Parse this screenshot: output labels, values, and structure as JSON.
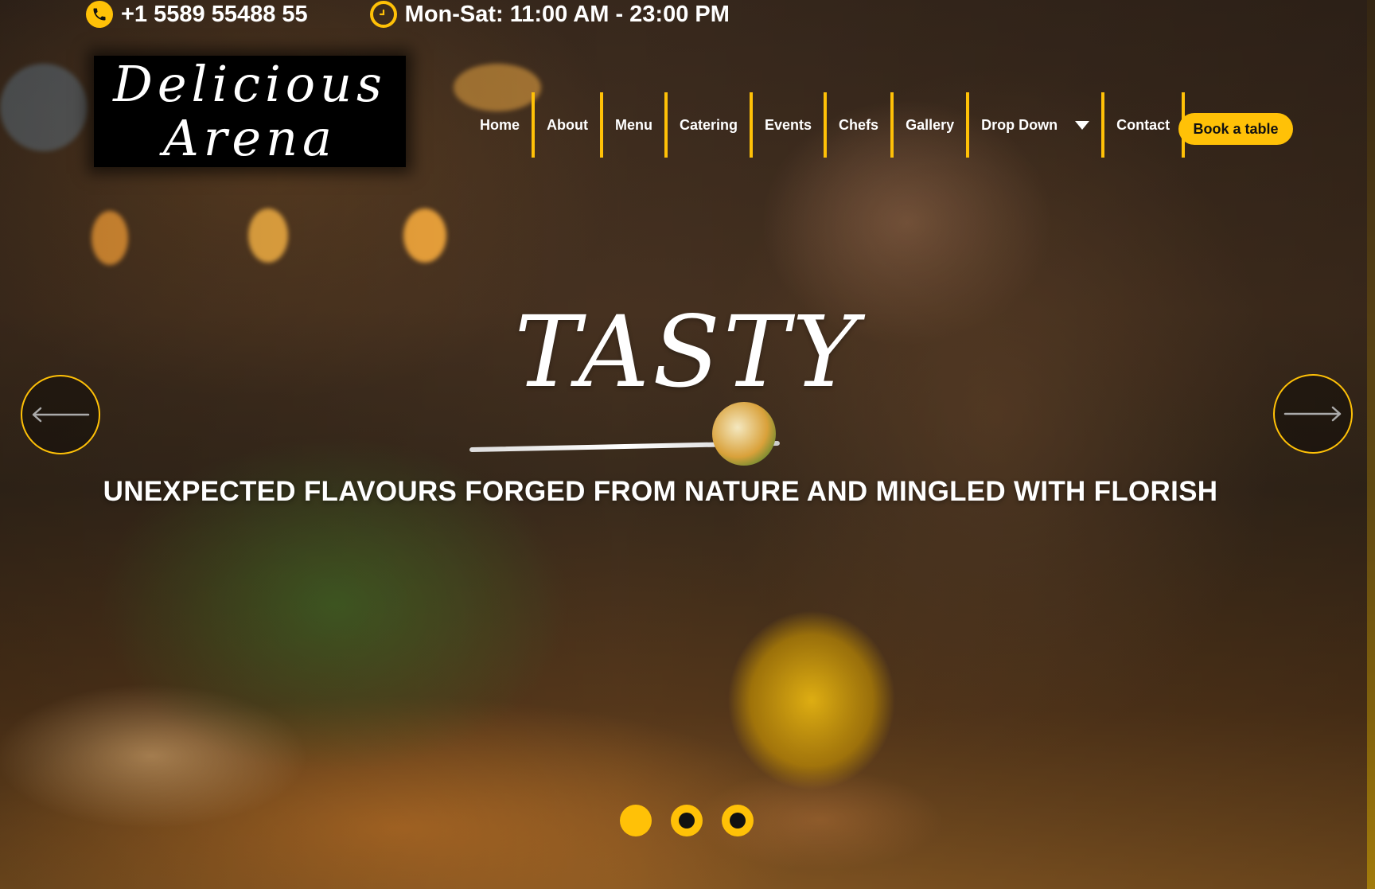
{
  "topbar": {
    "phone": "+1 5589 55488 55",
    "hours": "Mon-Sat: 11:00 AM - 23:00 PM"
  },
  "logo": {
    "line1": "Delicious",
    "line2": "Arena"
  },
  "nav": {
    "items": [
      {
        "label": "Home"
      },
      {
        "label": "About"
      },
      {
        "label": "Menu"
      },
      {
        "label": "Catering"
      },
      {
        "label": "Events"
      },
      {
        "label": "Chefs"
      },
      {
        "label": "Gallery"
      },
      {
        "label": "Drop Down"
      },
      {
        "label": "Contact"
      }
    ],
    "book_label": "Book a table"
  },
  "hero": {
    "title": "TASTY",
    "subtitle": "UNEXPECTED FLAVOURS FORGED FROM NATURE AND MINGLED WITH FLORISH",
    "slide_count": 3,
    "active_slide": 1
  },
  "colors": {
    "accent": "#ffc107",
    "text": "#ffffff"
  },
  "icons": {
    "phone": "phone-icon",
    "hours": "clock-icon",
    "prev": "arrow-left-icon",
    "next": "arrow-right-icon",
    "dropdown": "caret-down-icon"
  }
}
